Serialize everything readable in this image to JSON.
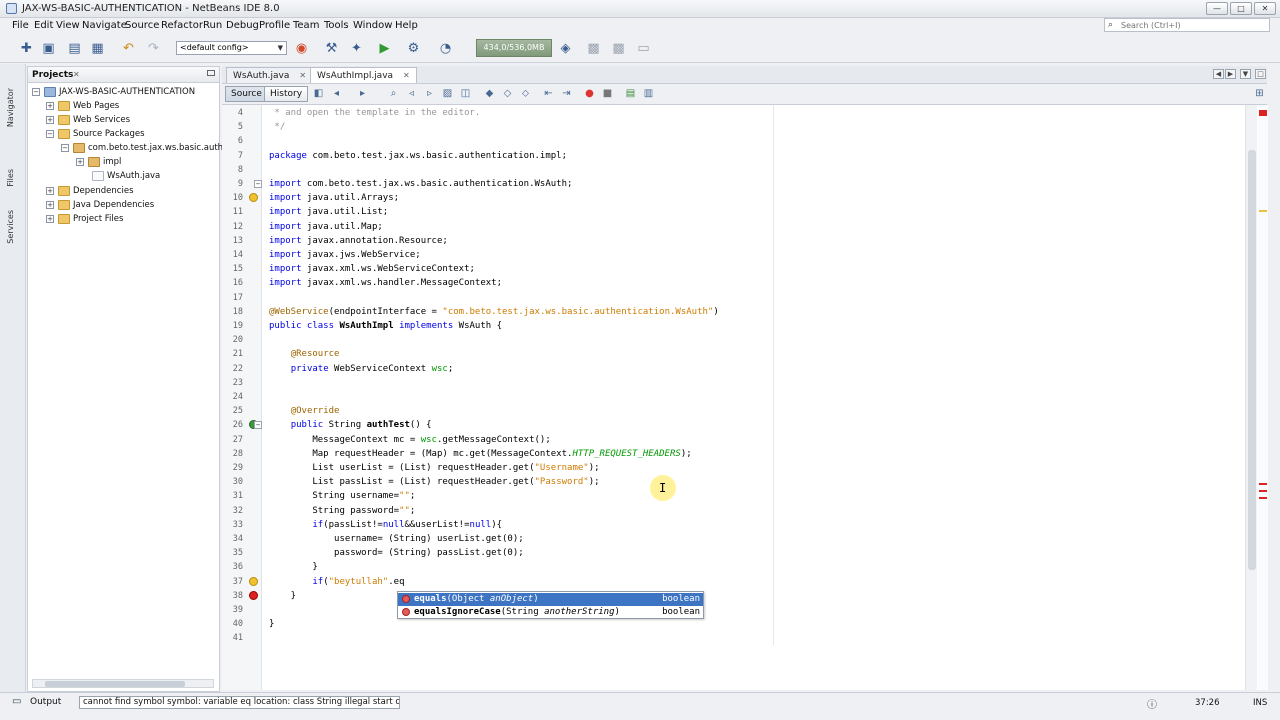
{
  "window": {
    "title": "JAX-WS-BASIC-AUTHENTICATION - NetBeans IDE 8.0",
    "minimize": "—",
    "maximize": "□",
    "close": "✕"
  },
  "menu": [
    "File",
    "Edit",
    "View",
    "Navigate",
    "Source",
    "Refactor",
    "Run",
    "Debug",
    "Profile",
    "Team",
    "Tools",
    "Window",
    "Help"
  ],
  "search": {
    "placeholder": "Search (Ctrl+I)"
  },
  "toolbar": {
    "config": "<default config>",
    "memory": "434,0/536,0MB"
  },
  "side_tabs": [
    "Navigator",
    "Files",
    "Services"
  ],
  "projects": {
    "tab_label": "Projects",
    "tree": [
      {
        "label": "JAX-WS-BASIC-AUTHENTICATION",
        "icon": "project-icon",
        "exp": "−"
      },
      {
        "label": "Web Pages",
        "icon": "folder-icon",
        "exp": "+"
      },
      {
        "label": "Web Services",
        "icon": "folder-icon",
        "exp": "+"
      },
      {
        "label": "Source Packages",
        "icon": "folder-icon",
        "exp": "−"
      },
      {
        "label": "com.beto.test.jax.ws.basic.authe",
        "icon": "package-icon",
        "exp": "−"
      },
      {
        "label": "impl",
        "icon": "package-icon",
        "exp": "+"
      },
      {
        "label": "WsAuth.java",
        "icon": "java-file-icon",
        "exp": ""
      },
      {
        "label": "Dependencies",
        "icon": "folder-icon",
        "exp": "+"
      },
      {
        "label": "Java Dependencies",
        "icon": "folder-icon",
        "exp": "+"
      },
      {
        "label": "Project Files",
        "icon": "folder-icon",
        "exp": "+"
      }
    ]
  },
  "editor_tabs": [
    {
      "label": "WsAuth.java",
      "active": false
    },
    {
      "label": "WsAuthImpl.java",
      "active": true
    }
  ],
  "editor_toolbar": {
    "source": "Source",
    "history": "History"
  },
  "code_lines": [
    {
      "n": "4",
      "tokens": [
        [
          "cmt",
          " * and open the template in the editor."
        ]
      ]
    },
    {
      "n": "5",
      "tokens": [
        [
          "cmt",
          " */"
        ]
      ]
    },
    {
      "n": "6",
      "tokens": []
    },
    {
      "n": "7",
      "tokens": [
        [
          "kw",
          "package"
        ],
        [
          "",
          " com.beto.test.jax.ws.basic.authentication.impl;"
        ]
      ]
    },
    {
      "n": "8",
      "tokens": []
    },
    {
      "n": "9",
      "tokens": [
        [
          "kw",
          "import"
        ],
        [
          "",
          " com.beto.test.jax.ws.basic.authentication.WsAuth;"
        ]
      ],
      "fold": "−"
    },
    {
      "n": "10",
      "tokens": [
        [
          "kw",
          "import"
        ],
        [
          "",
          " java.util.Arrays;"
        ]
      ],
      "mark": "bulb"
    },
    {
      "n": "11",
      "tokens": [
        [
          "kw",
          "import"
        ],
        [
          "",
          " java.util.List;"
        ]
      ]
    },
    {
      "n": "12",
      "tokens": [
        [
          "kw",
          "import"
        ],
        [
          "",
          " java.util.Map;"
        ]
      ]
    },
    {
      "n": "13",
      "tokens": [
        [
          "kw",
          "import"
        ],
        [
          "",
          " javax.annotation.Resource;"
        ]
      ]
    },
    {
      "n": "14",
      "tokens": [
        [
          "kw",
          "import"
        ],
        [
          "",
          " javax.jws.WebService;"
        ]
      ]
    },
    {
      "n": "15",
      "tokens": [
        [
          "kw",
          "import"
        ],
        [
          "",
          " javax.xml.ws.WebServiceContext;"
        ]
      ]
    },
    {
      "n": "16",
      "tokens": [
        [
          "kw",
          "import"
        ],
        [
          "",
          " javax.xml.ws.handler.MessageContext;"
        ]
      ]
    },
    {
      "n": "17",
      "tokens": []
    },
    {
      "n": "18",
      "tokens": [
        [
          "ann",
          "@WebService"
        ],
        [
          "",
          "(endpointInterface = "
        ],
        [
          "str",
          "\"com.beto.test.jax.ws.basic.authentication.WsAuth\""
        ],
        [
          "",
          ")"
        ]
      ]
    },
    {
      "n": "19",
      "tokens": [
        [
          "kw",
          "public class"
        ],
        [
          "",
          " "
        ],
        [
          "bold",
          "WsAuthImpl"
        ],
        [
          "",
          " "
        ],
        [
          "kw",
          "implements"
        ],
        [
          "",
          " WsAuth {"
        ]
      ]
    },
    {
      "n": "20",
      "tokens": []
    },
    {
      "n": "21",
      "tokens": [
        [
          "",
          "    "
        ],
        [
          "ann",
          "@Resource"
        ]
      ]
    },
    {
      "n": "22",
      "tokens": [
        [
          "",
          "    "
        ],
        [
          "kw",
          "private"
        ],
        [
          "",
          " WebServiceContext "
        ],
        [
          "field",
          "wsc"
        ],
        [
          "",
          ";"
        ]
      ]
    },
    {
      "n": "23",
      "tokens": []
    },
    {
      "n": "24",
      "tokens": []
    },
    {
      "n": "25",
      "tokens": [
        [
          "",
          "    "
        ],
        [
          "ann",
          "@Override"
        ]
      ]
    },
    {
      "n": "26",
      "tokens": [
        [
          "",
          "    "
        ],
        [
          "kw",
          "public"
        ],
        [
          "",
          " String "
        ],
        [
          "bold",
          "authTest"
        ],
        [
          "",
          "() {"
        ]
      ],
      "mark": "ovr",
      "fold": "−"
    },
    {
      "n": "27",
      "tokens": [
        [
          "",
          "        MessageContext mc = "
        ],
        [
          "field",
          "wsc"
        ],
        [
          "",
          ".getMessageContext();"
        ]
      ]
    },
    {
      "n": "28",
      "tokens": [
        [
          "",
          "        Map requestHeader = (Map) mc.get(MessageContext."
        ],
        [
          "static-field",
          "HTTP_REQUEST_HEADERS"
        ],
        [
          "",
          ");"
        ]
      ]
    },
    {
      "n": "29",
      "tokens": [
        [
          "",
          "        List userList = (List) requestHeader.get("
        ],
        [
          "str",
          "\"Username\""
        ],
        [
          "",
          ");"
        ]
      ]
    },
    {
      "n": "30",
      "tokens": [
        [
          "",
          "        List passList = (List) requestHeader.get("
        ],
        [
          "str",
          "\"Password\""
        ],
        [
          "",
          ");"
        ]
      ]
    },
    {
      "n": "31",
      "tokens": [
        [
          "",
          "        String username="
        ],
        [
          "str",
          "\"\""
        ],
        [
          "",
          ";"
        ]
      ]
    },
    {
      "n": "32",
      "tokens": [
        [
          "",
          "        String password="
        ],
        [
          "str",
          "\"\""
        ],
        [
          "",
          ";"
        ]
      ]
    },
    {
      "n": "33",
      "tokens": [
        [
          "",
          "        "
        ],
        [
          "kw",
          "if"
        ],
        [
          "",
          "(passList!="
        ],
        [
          "kw",
          "null"
        ],
        [
          "",
          "&&userList!="
        ],
        [
          "kw",
          "null"
        ],
        [
          "",
          "){"
        ]
      ]
    },
    {
      "n": "34",
      "tokens": [
        [
          "",
          "            username= (String) userList.get(0);"
        ]
      ]
    },
    {
      "n": "35",
      "tokens": [
        [
          "",
          "            password= (String) passList.get(0);"
        ]
      ]
    },
    {
      "n": "36",
      "tokens": [
        [
          "",
          "        }"
        ]
      ]
    },
    {
      "n": "37",
      "tokens": [
        [
          "",
          "        "
        ],
        [
          "kw",
          "if"
        ],
        [
          "",
          "("
        ],
        [
          "str",
          "\"beytullah\""
        ],
        [
          "",
          ".eq"
        ]
      ],
      "mark": "bulb"
    },
    {
      "n": "38",
      "tokens": [
        [
          "",
          "    }"
        ]
      ],
      "mark": "err"
    },
    {
      "n": "39",
      "tokens": []
    },
    {
      "n": "40",
      "tokens": [
        [
          "",
          "}"
        ]
      ]
    },
    {
      "n": "41",
      "tokens": []
    }
  ],
  "completion": [
    {
      "name": "equals",
      "sig": "(Object ",
      "param": "anObject",
      "close": ")",
      "type": "boolean",
      "selected": true
    },
    {
      "name": "equalsIgnoreCase",
      "sig": "(String ",
      "param": "anotherString",
      "close": ")",
      "type": "boolean",
      "selected": false
    }
  ],
  "status": {
    "output_label": "Output",
    "message": "cannot find symbol   symbol:   variable eq   location: class String  illegal start of type",
    "position": "37:26",
    "mode": "INS"
  },
  "colors": {
    "keyword": "#0000e6",
    "string": "#ce7b00",
    "selection": "#3d74c4",
    "error": "#dd2222"
  }
}
